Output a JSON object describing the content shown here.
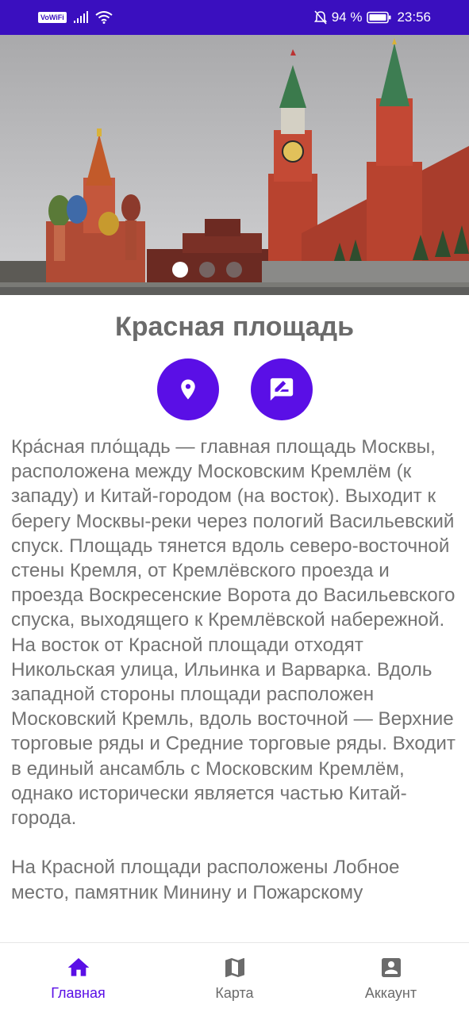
{
  "status": {
    "network_badge": "VoWiFi",
    "battery_percent": "94 %",
    "time": "23:56"
  },
  "carousel": {
    "image_icon": "red-square-photo",
    "pages": 3,
    "active_index": 0
  },
  "place": {
    "title": "Красная площадь",
    "description": "Кра́сная пло́щадь — главная площадь Москвы, расположена между Московским Кремлём (к западу) и Китай-городом (на восток). Выходит к берегу Москвы-реки через пологий Васильевский спуск. Площадь тянется вдоль северо-восточной стены Кремля, от Кремлёвского проезда и проезда Воскресенские Ворота до Васильевского спуска, выходящего к Кремлёвской набережной. На восток от Красной площади отходят Никольская улица, Ильинка и Варварка. Вдоль западной стороны площади расположен Московский Кремль, вдоль восточной — Верхние торговые ряды и Средние торговые ряды. Входит в единый ансамбль с Московским Кремлём, однако исторически является частью Китай-города.\n\nНа Красной площади расположены Лобное место, памятник Минину и Пожарскому"
  },
  "actions": {
    "location_icon": "location-pin-icon",
    "review_icon": "write-review-icon"
  },
  "nav": {
    "items": [
      {
        "label": "Главная",
        "icon": "home-icon",
        "active": true
      },
      {
        "label": "Карта",
        "icon": "map-icon",
        "active": false
      },
      {
        "label": "Аккаунт",
        "icon": "account-icon",
        "active": false
      }
    ]
  },
  "colors": {
    "accent": "#5a0fe6",
    "status_bar": "#3a0fbf",
    "text": "#737373"
  }
}
